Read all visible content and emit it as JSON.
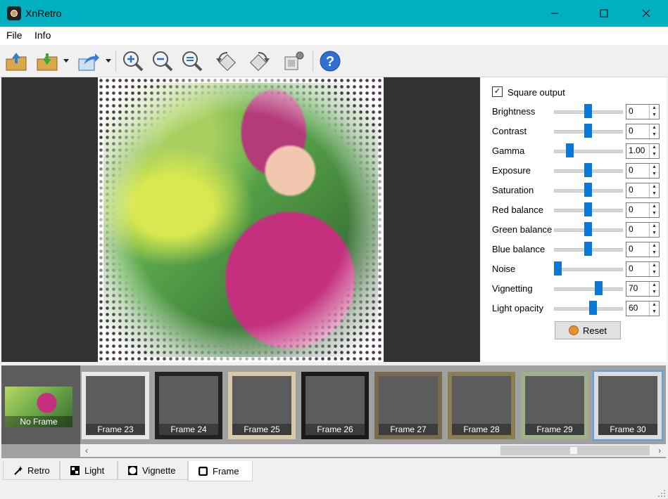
{
  "window": {
    "title": "XnRetro",
    "minimize_icon": "minimize-icon",
    "maximize_icon": "maximize-icon",
    "close_icon": "close-icon"
  },
  "menu": [
    {
      "label": "File"
    },
    {
      "label": "Info"
    }
  ],
  "toolbar": {
    "buttons": [
      "open-icon",
      "save-icon",
      "share-icon",
      "zoom-in-icon",
      "zoom-out-icon",
      "zoom-fit-icon",
      "rotate-left-icon",
      "rotate-right-icon",
      "screenshot-icon",
      "help-icon"
    ],
    "help_glyph": "?"
  },
  "settings": {
    "square_output": {
      "label": "Square output",
      "checked": true,
      "mark": "✓"
    },
    "sliders": [
      {
        "label": "Brightness",
        "value": "0",
        "level": 0.5
      },
      {
        "label": "Contrast",
        "value": "0",
        "level": 0.5
      },
      {
        "label": "Gamma",
        "value": "1.00",
        "level": 0.2
      },
      {
        "label": "Exposure",
        "value": "0",
        "level": 0.5
      },
      {
        "label": "Saturation",
        "value": "0",
        "level": 0.5
      },
      {
        "label": "Red balance",
        "value": "0",
        "level": 0.5
      },
      {
        "label": "Green balance",
        "value": "0",
        "level": 0.5
      },
      {
        "label": "Blue balance",
        "value": "0",
        "level": 0.5
      },
      {
        "label": "Noise",
        "value": "0",
        "level": 0.0
      },
      {
        "label": "Vignetting",
        "value": "70",
        "level": 0.67
      },
      {
        "label": "Light opacity",
        "value": "60",
        "level": 0.58
      }
    ],
    "reset_label": "Reset"
  },
  "frames": {
    "no_frame_label": "No Frame",
    "items": [
      {
        "label": "Frame 23",
        "border": "#e8e8e8"
      },
      {
        "label": "Frame 24",
        "border": "#222222"
      },
      {
        "label": "Frame 25",
        "border": "#d9c9a8"
      },
      {
        "label": "Frame 26",
        "border": "#1a1a1a"
      },
      {
        "label": "Frame 27",
        "border": "#7a6a50"
      },
      {
        "label": "Frame 28",
        "border": "#8a7f50"
      },
      {
        "label": "Frame 29",
        "border": "#9fb08a"
      },
      {
        "label": "Frame 30",
        "border": "#ffffff",
        "selected": true
      }
    ],
    "scroll_left": "‹",
    "scroll_right": "›"
  },
  "tabs": [
    {
      "label": "Retro",
      "icon": "magic-wand-icon"
    },
    {
      "label": "Light",
      "icon": "light-icon"
    },
    {
      "label": "Vignette",
      "icon": "vignette-icon"
    },
    {
      "label": "Frame",
      "icon": "frame-icon",
      "active": true
    }
  ],
  "colors": {
    "titlebar": "#00b0c0",
    "slider_thumb": "#0a78d7",
    "selection": "#5aa0e8"
  }
}
